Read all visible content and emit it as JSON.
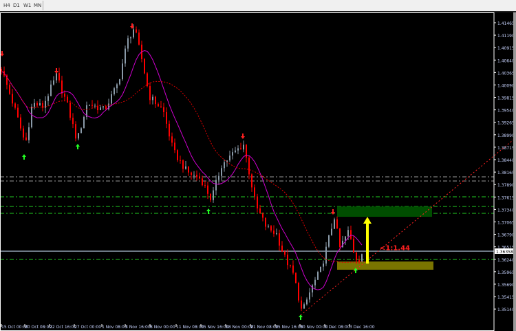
{
  "toolbar": {
    "tabs": [
      "H4",
      "D1",
      "W1",
      "MN"
    ]
  },
  "colors": {
    "bull": "#8a9aa8",
    "bear": "#ff0000",
    "ma_fast": "#d000d0",
    "ma_slow": "#e00000",
    "green_level": "#22cc22",
    "gray_level": "#9a9a9a",
    "red_level": "#cc0000",
    "green_box": "#004d00",
    "olive_box": "#7a7400",
    "arrow": "#ffff00",
    "axis": "#ffffff",
    "current": "#8fa0b0"
  },
  "chart_data": {
    "type": "candlestick",
    "ylim": [
      1.34853,
      1.41465
    ],
    "candle_count": 132,
    "key_closes": [
      [
        0,
        1.40447
      ],
      [
        2.5,
        1.39991
      ],
      [
        5,
        1.39535
      ],
      [
        8.75,
        1.38775
      ],
      [
        11.25,
        1.39687
      ],
      [
        15,
        1.39611
      ],
      [
        20,
        1.40295
      ],
      [
        23.75,
        1.39687
      ],
      [
        27.5,
        1.38851
      ],
      [
        31.25,
        1.39687
      ],
      [
        37.5,
        1.39535
      ],
      [
        42.5,
        1.40143
      ],
      [
        45.75,
        1.41055
      ],
      [
        48.25,
        1.41359
      ],
      [
        51.25,
        1.40599
      ],
      [
        53.75,
        1.39839
      ],
      [
        58.75,
        1.39535
      ],
      [
        62.5,
        1.38623
      ],
      [
        67.5,
        1.38167
      ],
      [
        72.5,
        1.38015
      ],
      [
        76.25,
        1.37559
      ],
      [
        80,
        1.38319
      ],
      [
        85,
        1.38623
      ],
      [
        88,
        1.38775
      ],
      [
        90,
        1.38167
      ],
      [
        92.5,
        1.37407
      ],
      [
        96.25,
        1.36951
      ],
      [
        100,
        1.36799
      ],
      [
        102.5,
        1.36343
      ],
      [
        106.25,
        1.35887
      ],
      [
        109.25,
        1.35051
      ],
      [
        112.5,
        1.35583
      ],
      [
        116.25,
        1.36039
      ],
      [
        118.75,
        1.36647
      ],
      [
        121,
        1.37179
      ],
      [
        123,
        1.36495
      ],
      [
        126.25,
        1.36875
      ],
      [
        128,
        1.36419
      ],
      [
        129.5,
        1.36191
      ],
      [
        131,
        1.36373
      ]
    ],
    "ma_periods": {
      "fast": 10,
      "slow": 26
    },
    "y_ticks": [
      "1.41465",
      "1.41190",
      "1.40915",
      "1.40640",
      "1.40365",
      "1.40090",
      "1.39815",
      "1.39540",
      "1.39265",
      "1.38990",
      "1.38715",
      "1.38440",
      "1.38165",
      "1.37890",
      "1.37615",
      "1.37340",
      "1.37065",
      "1.36790",
      "1.36515",
      "1.36240",
      "1.35965",
      "1.35690",
      "1.35415",
      "1.35140"
    ],
    "current_price": "1.36358",
    "x_ticks": [
      {
        "i": 0,
        "label": "15 Oct 00:00"
      },
      {
        "i": 8.5,
        "label": "20 Oct 08:00"
      },
      {
        "i": 17.5,
        "label": "22 Oct 16:00"
      },
      {
        "i": 26.5,
        "label": "27 Oct 00:00"
      },
      {
        "i": 36.5,
        "label": "1 Nov 08:00"
      },
      {
        "i": 45,
        "label": "3 Nov 16:00"
      },
      {
        "i": 54,
        "label": "8 Nov 00:00"
      },
      {
        "i": 63.5,
        "label": "11 Nov 08:00"
      },
      {
        "i": 72.5,
        "label": "15 Nov 16:00"
      },
      {
        "i": 81.5,
        "label": "18 Nov 00:00"
      },
      {
        "i": 90.5,
        "label": "21 Nov 08:00"
      },
      {
        "i": 99.5,
        "label": "25 Nov 16:00"
      },
      {
        "i": 108.5,
        "label": "30 Nov 00:00"
      },
      {
        "i": 117.5,
        "label": "1 Dec 08:00"
      },
      {
        "i": 126.5,
        "label": "3 Dec 16:00"
      }
    ],
    "levels": [
      {
        "p": 1.3806,
        "c": "gray"
      },
      {
        "p": 1.37969,
        "c": "gray"
      },
      {
        "p": 1.37619,
        "c": "green"
      },
      {
        "p": 1.37406,
        "c": "green"
      },
      {
        "p": 1.37254,
        "c": "green"
      },
      {
        "p": 1.36237,
        "c": "green"
      }
    ],
    "current_line": 1.36419,
    "boxes": [
      {
        "name": "target-zone",
        "i0": 122,
        "i1": 156.5,
        "p0": 1.37406,
        "p1": 1.37178,
        "c": "green_box"
      },
      {
        "name": "stop-zone",
        "i0": 122,
        "i1": 157,
        "p0": 1.36191,
        "p1": 1.36009,
        "c": "olive_box"
      }
    ],
    "target_arrow": {
      "i": 133,
      "from": 1.36145,
      "to": 1.37178
    },
    "ratio_label": {
      "i": 137.5,
      "p": 1.365,
      "text": "<1:1.44"
    },
    "trendline": {
      "i0": 108.75,
      "p0": 1.35005,
      "i1": 187,
      "p1": 1.38927
    },
    "fractals_down": [
      [
        0.25,
        1.40781
      ],
      [
        20,
        1.40401
      ],
      [
        47.5,
        1.41389
      ],
      [
        87.75,
        1.38957
      ],
      [
        120.5,
        1.37285
      ]
    ],
    "fractals_up": [
      [
        8.25,
        1.38501
      ],
      [
        27.75,
        1.38729
      ],
      [
        75.25,
        1.373
      ],
      [
        108.75,
        1.34959
      ],
      [
        128.75,
        1.35993
      ]
    ]
  }
}
